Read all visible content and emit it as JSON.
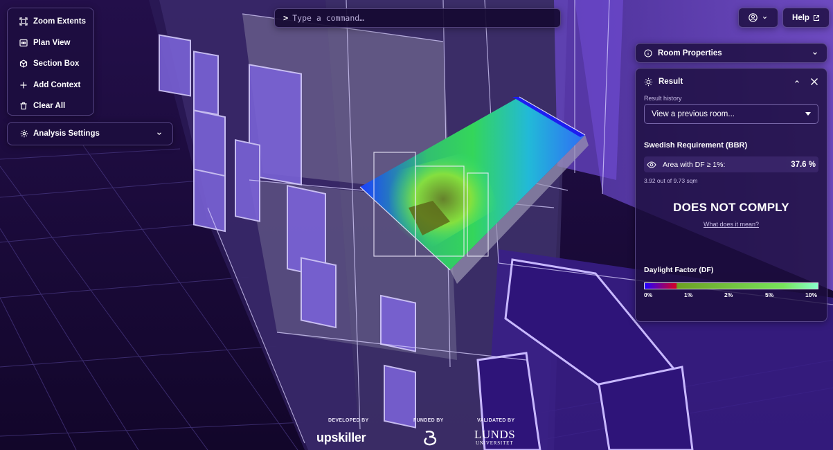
{
  "toolbar": {
    "items": [
      {
        "label": "Zoom Extents",
        "icon": "zoom-extents-icon"
      },
      {
        "label": "Plan View",
        "icon": "plan-view-icon"
      },
      {
        "label": "Section Box",
        "icon": "cube-icon"
      },
      {
        "label": "Add Context",
        "icon": "plus-icon"
      },
      {
        "label": "Clear All",
        "icon": "trash-icon"
      }
    ]
  },
  "analysis_settings": {
    "label": "Analysis Settings"
  },
  "command": {
    "prompt": ">",
    "placeholder": "Type a command…"
  },
  "help": {
    "label": "Help"
  },
  "room_properties": {
    "label": "Room Properties"
  },
  "result": {
    "title": "Result",
    "history_label": "Result history",
    "history_value": "View a previous room...",
    "requirement_title": "Swedish Requirement (BBR)",
    "metric_label": "Area with DF ≥ 1%:",
    "metric_value": "37.6 %",
    "area_note": "3.92 out of 9.73 sqm",
    "verdict": "DOES NOT COMPLY",
    "verdict_link": "What does it mean?",
    "df_title": "Daylight Factor (DF)",
    "df_ticks": [
      "0%",
      "1%",
      "2%",
      "5%",
      "10%"
    ]
  },
  "footer": {
    "developed_by": "DEVELOPED BY",
    "developer": "upskiller",
    "funded_by": "FUNDED BY",
    "validated_by": "VALIDATED BY",
    "validator": "LUNDS",
    "validator_sub": "UNIVERSITET"
  },
  "colors": {
    "background": "#1a0b3a",
    "panel": "#1c0e3e",
    "accent": "#7c5ce0",
    "verdict_text": "#ffffff"
  }
}
